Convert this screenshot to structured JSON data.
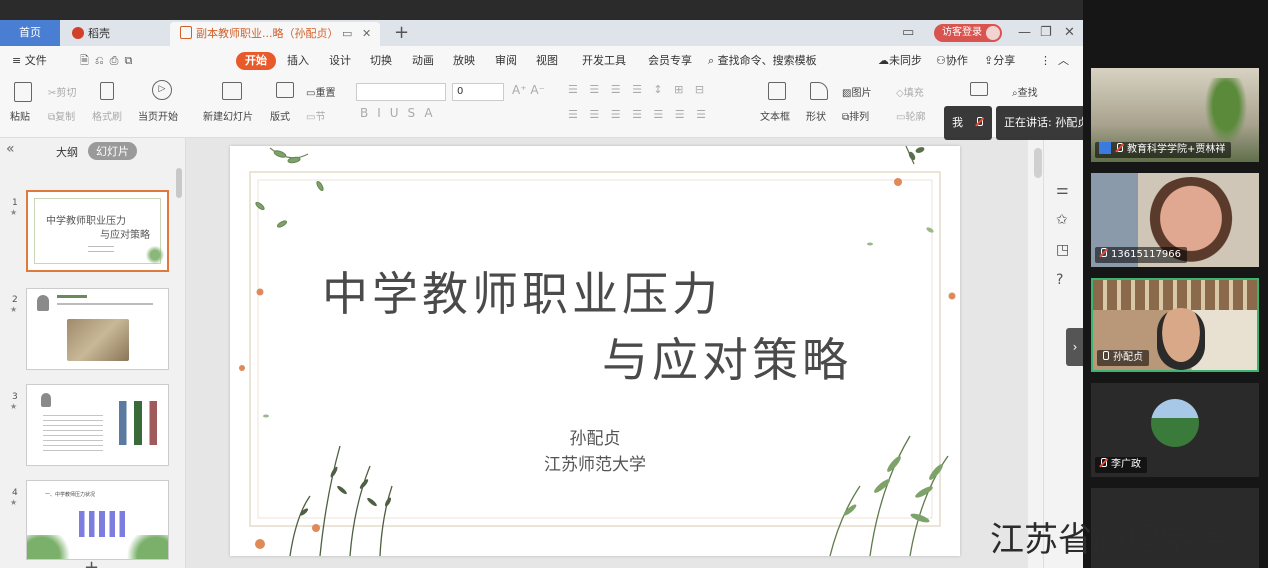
{
  "tabs": {
    "home": "首页",
    "docer": "稻壳",
    "document": "副本教师职业...略（孙配贞）",
    "guest_login": "访客登录"
  },
  "menu": {
    "file": "≡ 文件",
    "start": "开始",
    "insert": "插入",
    "design": "设计",
    "switch": "切换",
    "animation": "动画",
    "slideshow": "放映",
    "review": "审阅",
    "view": "视图",
    "developer": "开发工具",
    "member": "会员专享",
    "search_cmd": "查找命令、搜索模板",
    "unsync": "未同步",
    "collab": "协作",
    "share": "分享"
  },
  "ribbon": {
    "paste": "粘贴",
    "cut": "剪切",
    "copy": "复制",
    "format_painter": "格式刷",
    "from_start": "当页开始",
    "new_slide": "新建幻灯片",
    "layout": "版式",
    "section": "节",
    "reset": "重置",
    "font_size": "0",
    "text_box": "文本框",
    "shape": "形状",
    "picture": "图片",
    "arrange": "排列",
    "fill": "填充",
    "outline": "轮廓",
    "find": "查找"
  },
  "left_panel": {
    "outline_tab": "大纲",
    "slides_tab": "幻灯片",
    "thumbs": [
      {
        "num": "1",
        "title1": "中学教师职业压力",
        "title2": "与应对策略"
      },
      {
        "num": "2"
      },
      {
        "num": "3"
      },
      {
        "num": "4",
        "caption": "一、中学教师压力状况"
      }
    ]
  },
  "slide": {
    "title_line1": "中学教师职业压力",
    "title_line2": "与应对策略",
    "author": "孙配贞",
    "affiliation": "江苏师范大学"
  },
  "meeting": {
    "me_label": "我",
    "speaking_label": "正在讲话: 孙配贞;",
    "participants": [
      {
        "name": "教育科学学院+贾林祥"
      },
      {
        "name": "13615117966"
      },
      {
        "name": "孙配贞"
      },
      {
        "name": "李广政"
      }
    ]
  },
  "watermark": "江苏省心理学会",
  "colors": {
    "accent_orange": "#e85a2a",
    "home_tab_blue": "#4a7ed3",
    "guest_red": "#d9534f",
    "active_speaker_green": "#3cb371"
  }
}
